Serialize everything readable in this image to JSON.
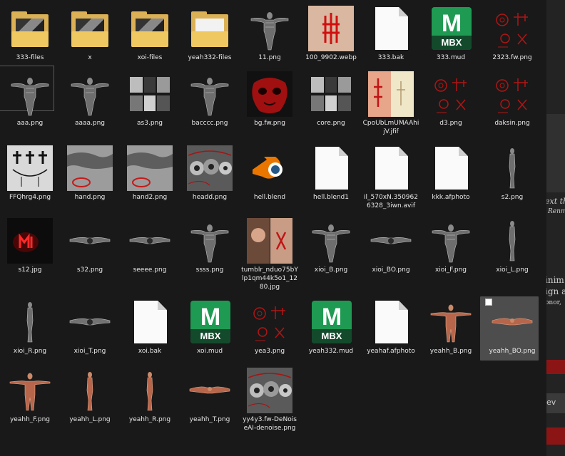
{
  "items": [
    {
      "label": "333-files",
      "icon": "folder-icon",
      "kind": "folder",
      "variant": "dark"
    },
    {
      "label": "x",
      "icon": "folder-icon",
      "kind": "folder",
      "variant": "dark"
    },
    {
      "label": "xoi-files",
      "icon": "folder-icon",
      "kind": "folder",
      "variant": "dark"
    },
    {
      "label": "yeah332-files",
      "icon": "folder-icon",
      "kind": "folder",
      "variant": "plain"
    },
    {
      "label": "11.png",
      "icon": "grey-figure-thumbnail",
      "kind": "figure"
    },
    {
      "label": "100_9902.webp",
      "icon": "red-sigil-photo-thumbnail",
      "kind": "photo-sigil"
    },
    {
      "label": "333.bak",
      "icon": "blank-document-icon",
      "kind": "doc"
    },
    {
      "label": "333.mud",
      "icon": "mbx-icon",
      "kind": "mbx"
    },
    {
      "label": "2323.fw.png",
      "icon": "red-symbols-thumbnail",
      "kind": "redsym"
    },
    {
      "label": "aaa.png",
      "icon": "grey-figure-thumbnail",
      "kind": "figure",
      "boxed": true
    },
    {
      "label": "aaaa.png",
      "icon": "grey-figure-thumbnail",
      "kind": "figure"
    },
    {
      "label": "as3.png",
      "icon": "collage-thumbnail",
      "kind": "collage"
    },
    {
      "label": "bacccc.png",
      "icon": "grey-figure-thumbnail",
      "kind": "figure"
    },
    {
      "label": "bg.fw.png",
      "icon": "red-face-thumbnail",
      "kind": "redface"
    },
    {
      "label": "core.png",
      "icon": "collage-thumbnail",
      "kind": "collage"
    },
    {
      "label": "CpoUbLmUMAAhijV.jfif",
      "icon": "arm-photo-thumbnail",
      "kind": "arm"
    },
    {
      "label": "d3.png",
      "icon": "red-symbols-thumbnail",
      "kind": "redsym"
    },
    {
      "label": "daksin.png",
      "icon": "red-symbols-thumbnail",
      "kind": "redsym"
    },
    {
      "label": "FFQhrg4.png",
      "icon": "crosses-thumbnail",
      "kind": "crosses"
    },
    {
      "label": "hand.png",
      "icon": "hand-thumbnail",
      "kind": "hand"
    },
    {
      "label": "hand2.png",
      "icon": "hand-thumbnail",
      "kind": "hand"
    },
    {
      "label": "headd.png",
      "icon": "heads-thumbnail",
      "kind": "heads"
    },
    {
      "label": "hell.blend",
      "icon": "blender-icon",
      "kind": "blender"
    },
    {
      "label": "hell.blend1",
      "icon": "blank-document-icon",
      "kind": "doc"
    },
    {
      "label": "il_570xN.3509626328_3iwn.avif",
      "icon": "blank-document-icon",
      "kind": "doc"
    },
    {
      "label": "kkk.afphoto",
      "icon": "blank-document-icon",
      "kind": "doc"
    },
    {
      "label": "s2.png",
      "icon": "side-figure-thumbnail",
      "kind": "side"
    },
    {
      "label": "s12.jpg",
      "icon": "red-glow-thumbnail",
      "kind": "redglow"
    },
    {
      "label": "s32.png",
      "icon": "flat-figure-thumbnail",
      "kind": "flat"
    },
    {
      "label": "seeee.png",
      "icon": "flat-figure-thumbnail",
      "kind": "flat"
    },
    {
      "label": "ssss.png",
      "icon": "grey-figure-thumbnail",
      "kind": "figure"
    },
    {
      "label": "tumblr_nduo75bYlp1qm44k5o1_1280.jpg",
      "icon": "person-photo-thumbnail",
      "kind": "person"
    },
    {
      "label": "xioi_B.png",
      "icon": "grey-figure-thumbnail",
      "kind": "figure"
    },
    {
      "label": "xioi_BO.png",
      "icon": "flat-figure-thumbnail",
      "kind": "flat"
    },
    {
      "label": "xioi_F.png",
      "icon": "grey-figure-thumbnail",
      "kind": "figure"
    },
    {
      "label": "xioi_L.png",
      "icon": "side-figure-thumbnail",
      "kind": "side"
    },
    {
      "label": "xioi_R.png",
      "icon": "side-figure-thumbnail",
      "kind": "side"
    },
    {
      "label": "xioi_T.png",
      "icon": "flat-figure-thumbnail",
      "kind": "flat"
    },
    {
      "label": "xoi.bak",
      "icon": "blank-document-icon",
      "kind": "doc"
    },
    {
      "label": "xoi.mud",
      "icon": "mbx-icon",
      "kind": "mbx"
    },
    {
      "label": "yea3.png",
      "icon": "red-symbols-thumbnail",
      "kind": "redsym"
    },
    {
      "label": "yeah332.mud",
      "icon": "mbx-icon",
      "kind": "mbx"
    },
    {
      "label": "yeahaf.afphoto",
      "icon": "blank-document-icon",
      "kind": "doc"
    },
    {
      "label": "yeahh_B.png",
      "icon": "skin-figure-thumbnail",
      "kind": "skin"
    },
    {
      "label": "yeahh_BO.png",
      "icon": "skin-flat-thumbnail",
      "kind": "skinflat",
      "selected": true
    },
    {
      "label": "yeahh_F.png",
      "icon": "skin-figure-thumbnail",
      "kind": "skin"
    },
    {
      "label": "yeahh_L.png",
      "icon": "skin-side-thumbnail",
      "kind": "skinside"
    },
    {
      "label": "yeahh_R.png",
      "icon": "skin-side-thumbnail",
      "kind": "skinside"
    },
    {
      "label": "yeahh_T.png",
      "icon": "skin-flat-thumbnail",
      "kind": "skinflat"
    },
    {
      "label": "yy4y3.fw-DeNoiseAI-denoise.png",
      "icon": "heads-thumbnail",
      "kind": "heads"
    }
  ],
  "mbx_text": {
    "letter": "M",
    "badge": "MBX"
  },
  "background_app": {
    "line1": "ext th",
    "line2": "Renm",
    "line3": "inim",
    "line4": "ign a",
    "line5": "onor,",
    "line6": "ev"
  },
  "colors": {
    "background": "#191919",
    "selected": "#4d4d4d",
    "mbx_green": "#1f9a52",
    "folder": "#dcb155"
  }
}
